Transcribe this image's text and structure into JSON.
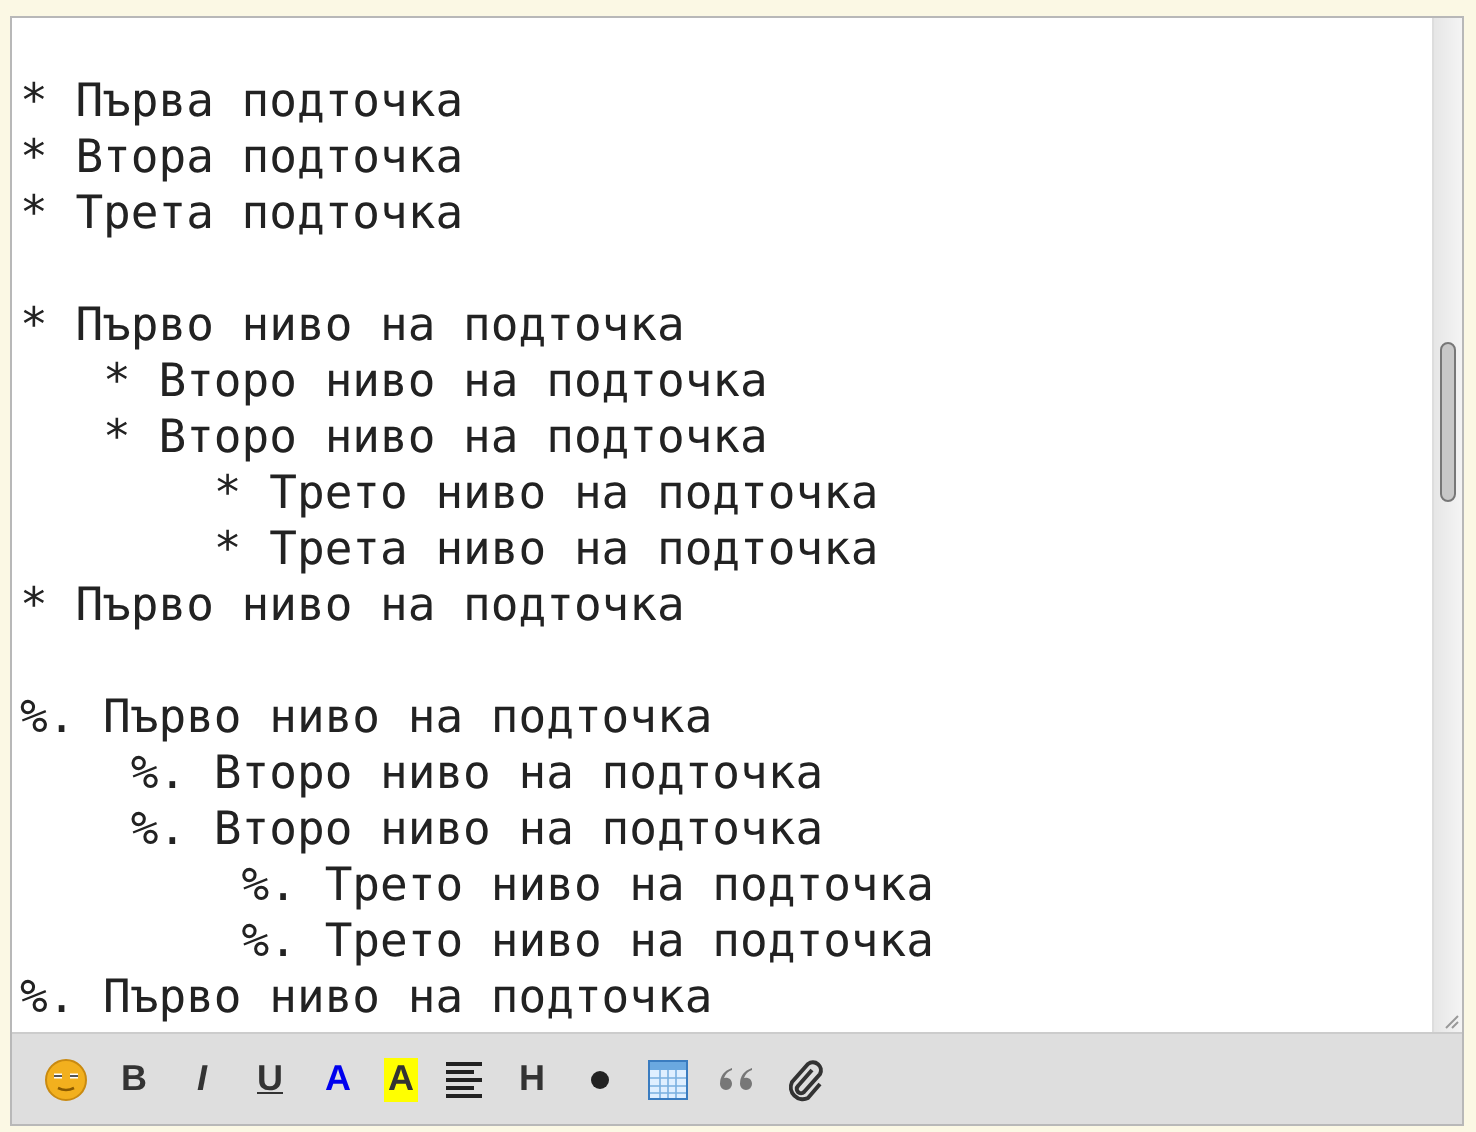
{
  "editor": {
    "groups": [
      {
        "lines": [
          "* Първа подточка",
          "* Втора подточка",
          "* Трета подточка"
        ]
      },
      {
        "lines": [
          "* Първо ниво на подточка",
          "   * Второ ниво на подточка",
          "   * Второ ниво на подточка",
          "       * Трето ниво на подточка",
          "       * Трета ниво на подточка",
          "* Първо ниво на подточка"
        ]
      },
      {
        "lines": [
          "%. Първо ниво на подточка",
          "    %. Второ ниво на подточка",
          "    %. Второ ниво на подточка",
          "        %. Трето ниво на подточка",
          "        %. Трето ниво на подточка",
          "%. Първо ниво на подточка"
        ]
      }
    ]
  },
  "toolbar": [
    {
      "kind": "emoji"
    },
    {
      "kind": "bold",
      "label": "B"
    },
    {
      "kind": "italic",
      "label": "I"
    },
    {
      "kind": "underline",
      "label": "U"
    },
    {
      "kind": "color",
      "label": "A"
    },
    {
      "kind": "highlight",
      "label": "A"
    },
    {
      "kind": "align"
    },
    {
      "kind": "heading",
      "label": "H"
    },
    {
      "kind": "bullet"
    },
    {
      "kind": "table"
    },
    {
      "kind": "quote"
    },
    {
      "kind": "attach"
    }
  ]
}
